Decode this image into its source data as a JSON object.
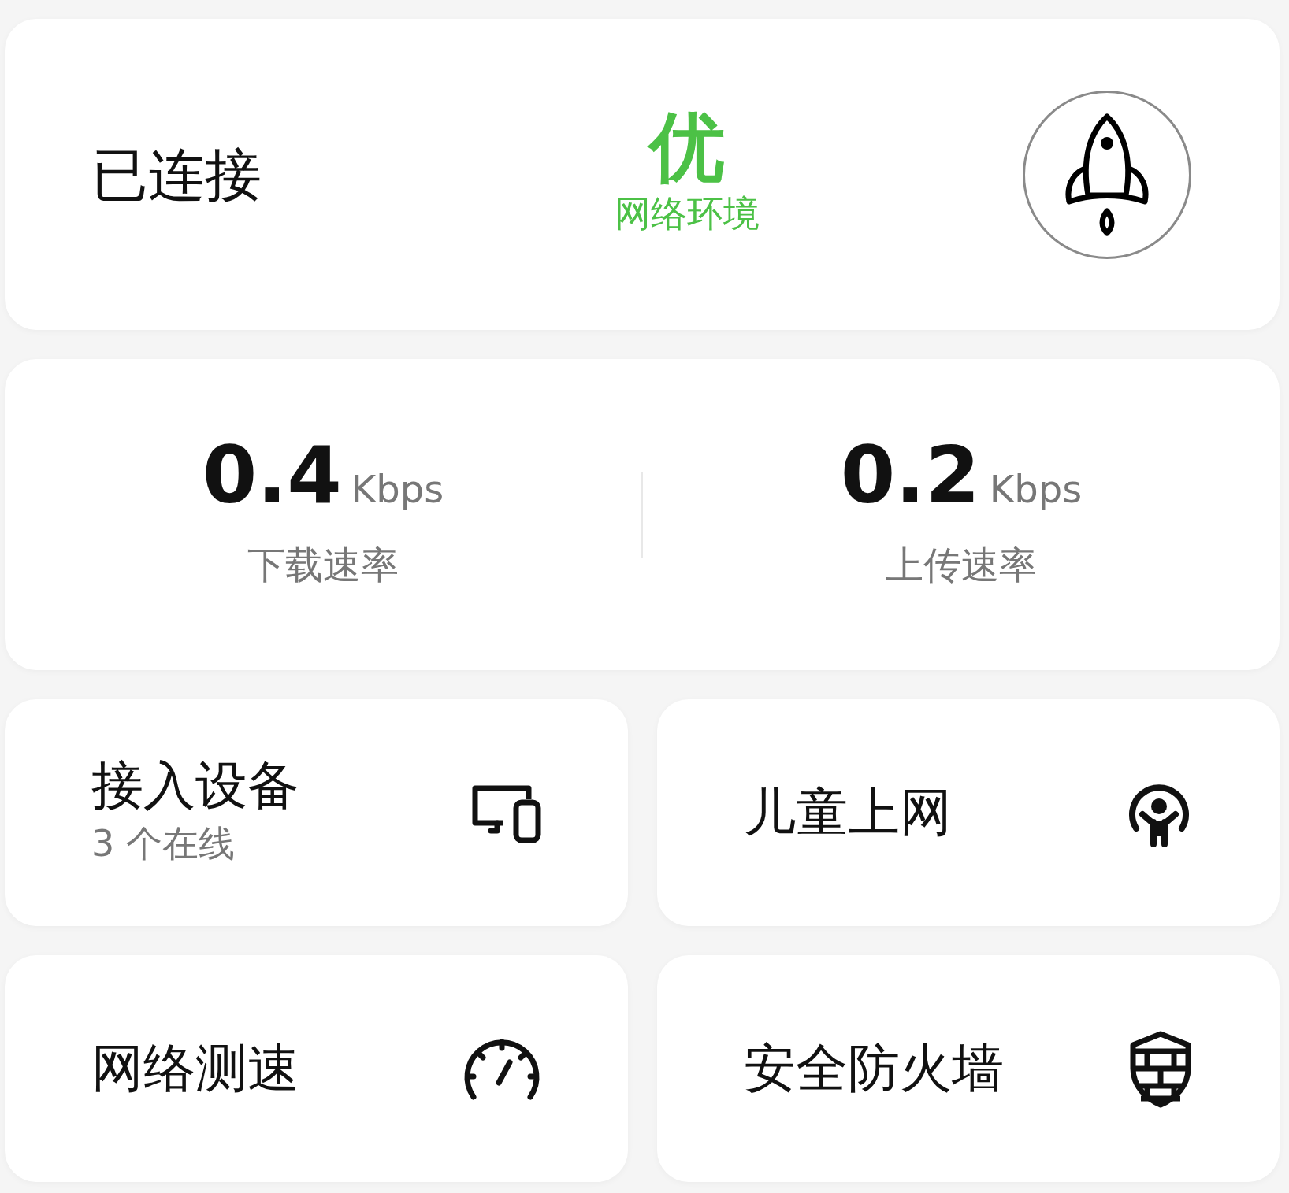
{
  "connection": {
    "status": "已连接",
    "quality": "优",
    "quality_label": "网络环境"
  },
  "speeds": [
    {
      "value": "0.4",
      "unit": "Kbps",
      "label": "下载速率"
    },
    {
      "value": "0.2",
      "unit": "Kbps",
      "label": "上传速率"
    }
  ],
  "tiles": [
    {
      "kind": "devices",
      "title": "接入设备",
      "subtitle": "3 个在线"
    },
    {
      "kind": "child",
      "title": "儿童上网"
    },
    {
      "kind": "speedtest",
      "title": "网络测速"
    },
    {
      "kind": "firewall",
      "title": "安全防火墙"
    }
  ]
}
